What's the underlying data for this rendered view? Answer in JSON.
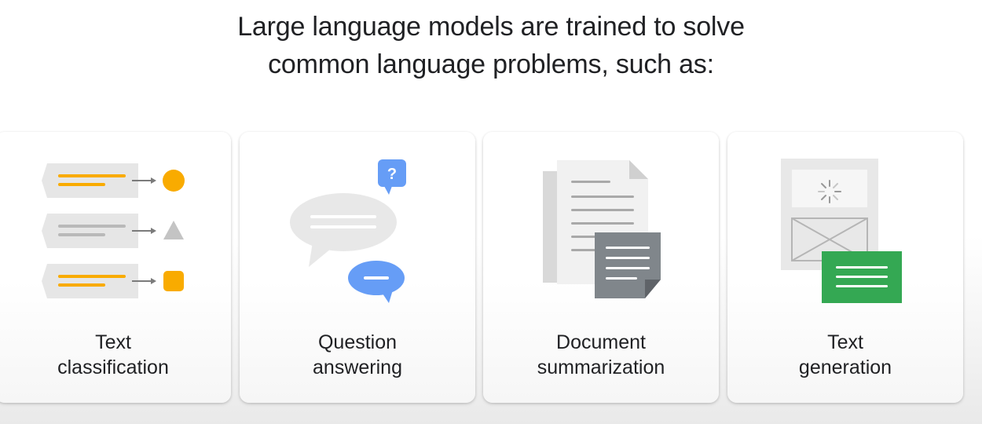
{
  "heading": {
    "line1": "Large language models are trained to solve",
    "line2": "common language problems, such as:"
  },
  "cards": [
    {
      "line1": "Text",
      "line2": "classification",
      "icon": "text-classification-icon"
    },
    {
      "line1": "Question",
      "line2": "answering",
      "icon": "question-answering-icon"
    },
    {
      "line1": "Document",
      "line2": "summarization",
      "icon": "document-summarization-icon"
    },
    {
      "line1": "Text",
      "line2": "generation",
      "icon": "text-generation-icon"
    }
  ],
  "question_mark": "?",
  "colors": {
    "yellow": "#F9AB00",
    "blue": "#669DF6",
    "green": "#34A853",
    "gray_light": "#E8EAED",
    "gray_mid": "#BDC1C6",
    "gray_dark": "#80868B"
  }
}
